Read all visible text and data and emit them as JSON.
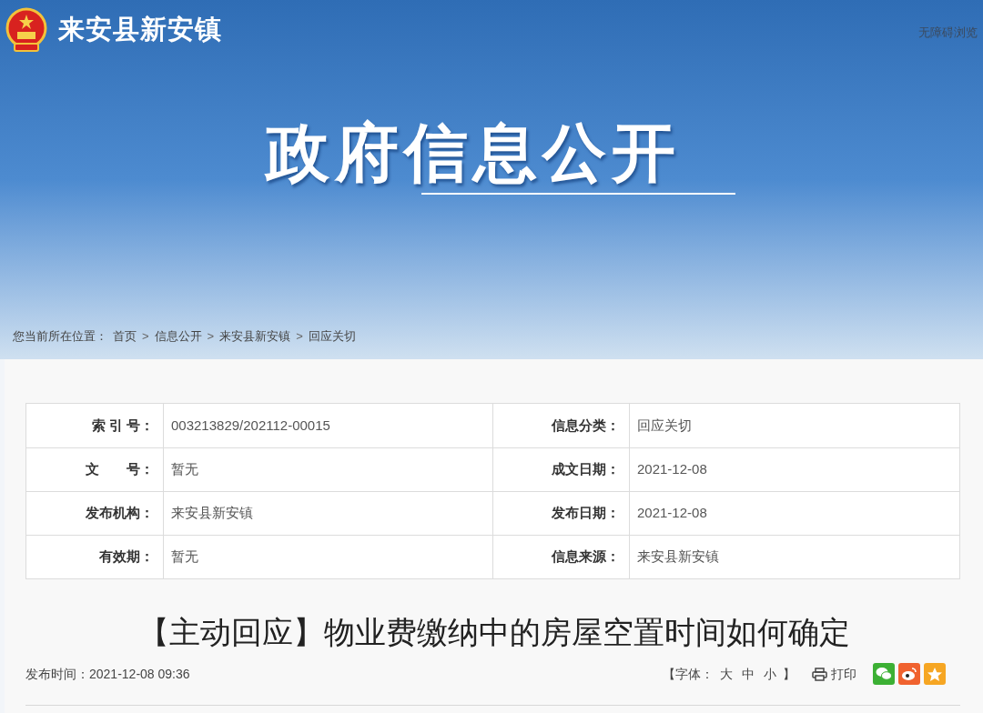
{
  "site": {
    "name": "来安县新安镇",
    "accessibility_link": "无障碍浏览"
  },
  "banner": {
    "title": "政府信息公开"
  },
  "breadcrumb": {
    "prefix": "您当前所在位置：",
    "items": [
      {
        "kind": "link",
        "text": "首页"
      },
      {
        "kind": "separator",
        "text": ">"
      },
      {
        "kind": "link",
        "text": "信息公开"
      },
      {
        "kind": "separator",
        "text": ">"
      },
      {
        "kind": "link",
        "text": "来安县新安镇"
      },
      {
        "kind": "separator",
        "text": ">"
      },
      {
        "kind": "link",
        "text": "回应关切"
      }
    ]
  },
  "info_table": {
    "rows": [
      [
        {
          "label": "索 引 号：",
          "value": "003213829/202112-00015"
        },
        {
          "label": "信息分类：",
          "value": "回应关切"
        }
      ],
      [
        {
          "label": "文　　号：",
          "value": "暂无"
        },
        {
          "label": "成文日期：",
          "value": "2021-12-08"
        }
      ],
      [
        {
          "label": "发布机构：",
          "value": "来安县新安镇"
        },
        {
          "label": "发布日期：",
          "value": "2021-12-08"
        }
      ],
      [
        {
          "label": "有效期：",
          "value": "暂无"
        },
        {
          "label": "信息来源：",
          "value": "来安县新安镇"
        }
      ]
    ]
  },
  "article": {
    "title": "【主动回应】物业费缴纳中的房屋空置时间如何确定",
    "publish_time": "发布时间：2021-12-08 09:36",
    "font_size": {
      "open": "【字体：",
      "options": [
        "大",
        "中",
        "小"
      ],
      "close": "】"
    },
    "print": "打印",
    "share": [
      {
        "kind": "wechat",
        "color": "#3cb034"
      },
      {
        "kind": "weibo",
        "color": "#f0622f"
      },
      {
        "kind": "favorite",
        "color": "#f6a623"
      }
    ]
  }
}
